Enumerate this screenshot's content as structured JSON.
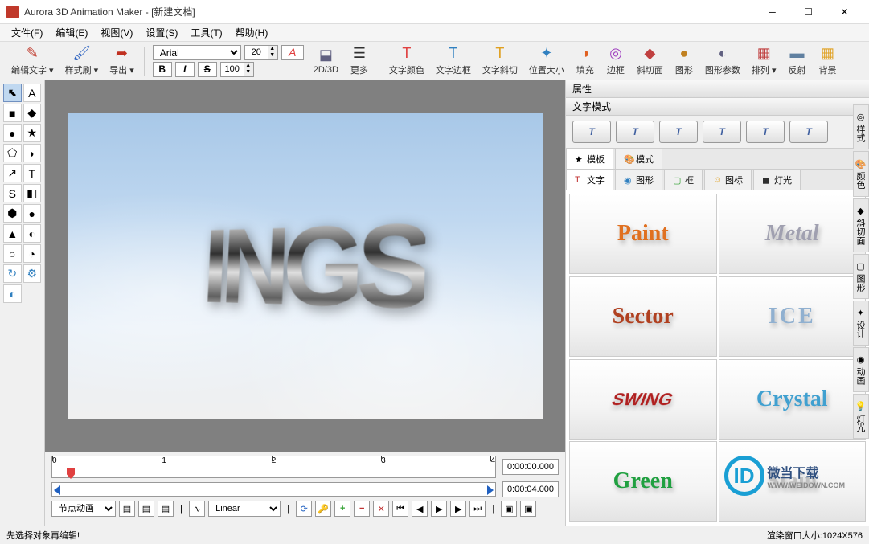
{
  "window": {
    "title": "Aurora 3D Animation Maker - [新建文档]"
  },
  "menu": [
    "文件(F)",
    "编辑(E)",
    "视图(V)",
    "设置(S)",
    "工具(T)",
    "帮助(H)"
  ],
  "toolbar_left": [
    {
      "label": "编辑文字",
      "icon": "✎",
      "color": "#c0392b"
    },
    {
      "label": "样式刷",
      "icon": "🖌",
      "color": "#2a60c0"
    },
    {
      "label": "导出",
      "icon": "➦",
      "color": "#c03020"
    }
  ],
  "font": {
    "family": "Arial",
    "size": "20",
    "depth": "100"
  },
  "style_btns": {
    "bold": "B",
    "italic": "I",
    "strike": "S"
  },
  "mode_btns": {
    "m2d3d": "2D/3D",
    "more": "更多"
  },
  "toolbar_right": [
    {
      "label": "文字颜色",
      "icon": "T",
      "color": "#e04040"
    },
    {
      "label": "文字边框",
      "icon": "T",
      "color": "#3080c0"
    },
    {
      "label": "文字斜切",
      "icon": "T",
      "color": "#e0a020"
    },
    {
      "label": "位置大小",
      "icon": "✦",
      "color": "#3080c0"
    },
    {
      "label": "填充",
      "icon": "◑",
      "color": "#e06020"
    },
    {
      "label": "边框",
      "icon": "◎",
      "color": "#a040c0"
    },
    {
      "label": "斜切面",
      "icon": "◆",
      "color": "#c04040"
    },
    {
      "label": "图形",
      "icon": "●",
      "color": "#c08020"
    },
    {
      "label": "图形参数",
      "icon": "◐",
      "color": "#606080"
    },
    {
      "label": "排列",
      "icon": "▦",
      "color": "#c04040"
    },
    {
      "label": "反射",
      "icon": "▬",
      "color": "#6080a0"
    },
    {
      "label": "背景",
      "icon": "▦",
      "color": "#e0a020"
    }
  ],
  "viewport_text": "INGS",
  "timeline": {
    "marks": [
      "0",
      "1",
      "2",
      "3",
      "4"
    ],
    "start": "0:00:00.000",
    "end": "0:00:04.000",
    "node_label": "节点动画",
    "curve": "Linear"
  },
  "properties": {
    "title": "属性",
    "mode_title": "文字模式"
  },
  "top_tabs": [
    {
      "label": "模板",
      "icon": "★"
    },
    {
      "label": "模式",
      "icon": "🎨"
    }
  ],
  "sub_tabs": [
    {
      "label": "文字",
      "icon": "T",
      "color": "#c03030"
    },
    {
      "label": "图形",
      "icon": "◉",
      "color": "#3080c0"
    },
    {
      "label": "框",
      "icon": "▢",
      "color": "#30a030"
    },
    {
      "label": "图标",
      "icon": "☺",
      "color": "#e0a020"
    },
    {
      "label": "灯光",
      "icon": "◼",
      "color": "#303030"
    }
  ],
  "presets": [
    {
      "text": "Paint",
      "style": "color:#e07020;font-family:Arial Black;"
    },
    {
      "text": "Metal",
      "style": "color:#a0a0b0;font-style:italic;font-family:'Brush Script MT',cursive;"
    },
    {
      "text": "Sector",
      "style": "color:#b04020;font-family:Arial Black;"
    },
    {
      "text": "ICE",
      "style": "color:#90b0d0;font-family:Georgia;letter-spacing:3px;"
    },
    {
      "text": "SWING",
      "style": "color:#b02020;font-family:Arial;transform:skewX(-20deg);font-size:22px;"
    },
    {
      "text": "Crystal",
      "style": "color:#40a0d0;font-family:Georgia;"
    },
    {
      "text": "Green",
      "style": "color:#20a040;font-family:Georgia;"
    },
    {
      "text": "Stain",
      "style": "color:#c0c0c0;font-family:Arial Black;"
    }
  ],
  "side_tabs": [
    "◎ 样式",
    "🎨 颜色",
    "◆ 斜切面",
    "▢ 图形",
    "✦ 设计",
    "◉ 动画",
    "💡 灯光"
  ],
  "status": {
    "left": "先选择对象再编辑!",
    "right": "渲染窗口大小:1024X576"
  },
  "watermark": "微当下载"
}
